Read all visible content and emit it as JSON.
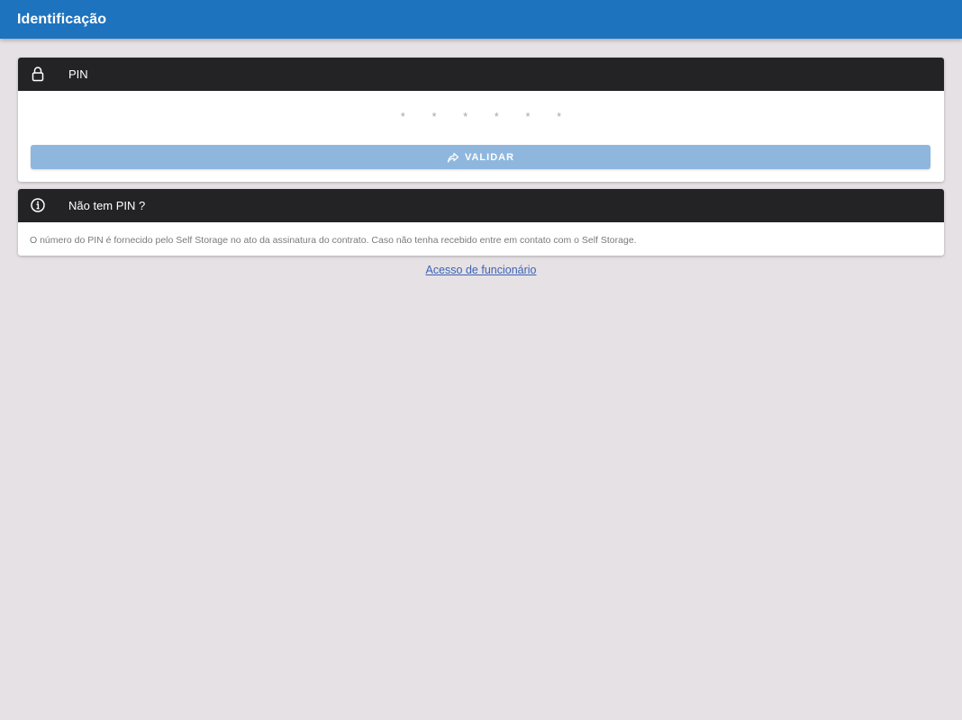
{
  "appbar": {
    "title": "Identificação",
    "color": "#1e73be"
  },
  "pin_card": {
    "title": "PIN",
    "icon": "lock-icon",
    "placeholder": "* * * * * *",
    "button_label": "VALIDAR",
    "button_icon": "share-arrow-icon"
  },
  "info_card": {
    "title": "Não tem PIN ?",
    "icon": "info-icon",
    "text": "O número do PIN é fornecido pelo Self Storage no ato da assinatura do contrato. Caso não tenha recebido entre em contato com o Self Storage."
  },
  "staff_link": "Acesso de funcionário"
}
